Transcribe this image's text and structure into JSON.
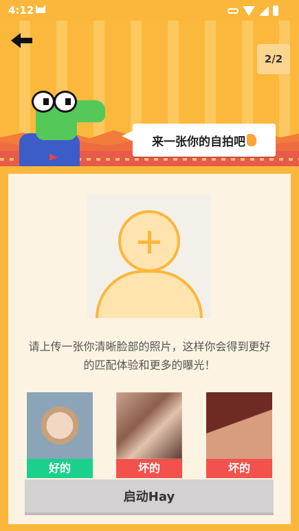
{
  "status_bar": {
    "time": "4:12"
  },
  "header": {
    "page_indicator": "2/2",
    "bubble_text": "来一张你的自拍吧"
  },
  "main": {
    "instruction": "请上传一张你清晰脸部的照片，这样你会得到更好的匹配体验和更多的曝光！",
    "samples": [
      {
        "label": "好的",
        "color": "#19D18C"
      },
      {
        "label": "坏的",
        "color": "#F2514C"
      },
      {
        "label": "坏的",
        "color": "#F2514C"
      }
    ],
    "start_label": "启动Hay"
  },
  "colors": {
    "accent": "#FBB73B",
    "card": "#FDF3E2",
    "good": "#19D18C",
    "bad": "#F2514C"
  }
}
